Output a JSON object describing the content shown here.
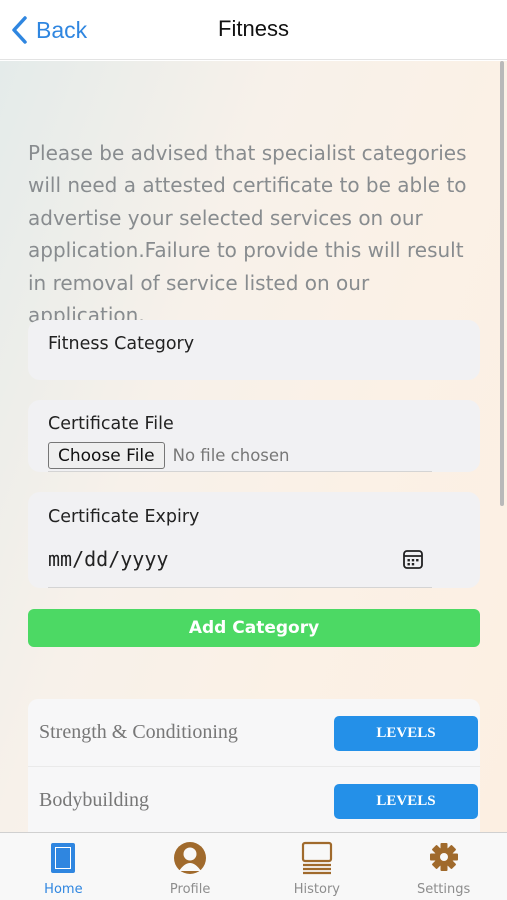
{
  "header": {
    "back_label": "Back",
    "title": "Fitness"
  },
  "notice": "Please be advised that specialist categories will need a attested certificate to be able to advertise your selected services on our application.Failure to provide this will result in removal of service listed on our application.",
  "form": {
    "category_label": "Fitness Category",
    "certificate_file_label": "Certificate File",
    "choose_file_label": "Choose File",
    "no_file_text": "No file chosen",
    "expiry_label": "Certificate Expiry",
    "expiry_placeholder": "mm/dd/yyyy",
    "add_button": "Add Category"
  },
  "categories": [
    {
      "name": "Strength & Conditioning",
      "button": "LEVELS"
    },
    {
      "name": "Bodybuilding",
      "button": "LEVELS"
    }
  ],
  "tabs": [
    {
      "label": "Home",
      "icon": "home-icon",
      "active": true
    },
    {
      "label": "Profile",
      "icon": "profile-icon",
      "active": false
    },
    {
      "label": "History",
      "icon": "history-icon",
      "active": false
    },
    {
      "label": "Settings",
      "icon": "gear-icon",
      "active": false
    }
  ],
  "colors": {
    "accent": "#2f86e0",
    "add_button": "#4cd964",
    "levels_button": "#2490e8",
    "tab_icon": "#a06a2c"
  }
}
